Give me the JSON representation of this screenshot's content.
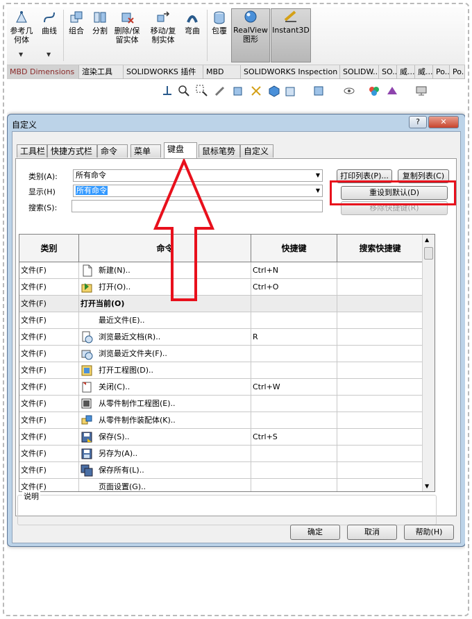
{
  "ribbon": {
    "buttons": [
      {
        "label": "参考几\n何体",
        "icon": "reference-geometry-icon"
      },
      {
        "label": "曲线",
        "icon": "curves-icon"
      },
      {
        "label": "组合",
        "icon": "combine-icon"
      },
      {
        "label": "分割",
        "icon": "split-icon"
      },
      {
        "label": "删除/保\n留实体",
        "icon": "delete-keep-body-icon"
      },
      {
        "label": "移动/复\n制实体",
        "icon": "move-copy-body-icon"
      },
      {
        "label": "弯曲",
        "icon": "flex-icon"
      },
      {
        "label": "包覆",
        "icon": "wrap-icon"
      },
      {
        "label": "RealView\n图形",
        "icon": "realview-icon"
      },
      {
        "label": "Instant3D",
        "icon": "instant3d-icon"
      }
    ]
  },
  "command_tabs": [
    "MBD Dimensions",
    "渲染工具",
    "SOLIDWORKS 插件",
    "MBD",
    "SOLIDWORKS Inspection",
    "SOLIDW...",
    "SO...",
    "威...",
    "威...",
    "Po...",
    "Po..."
  ],
  "dialog": {
    "title": "自定义",
    "help_label": "?",
    "close_label": "✕",
    "tabs": [
      "工具栏",
      "快捷方式栏",
      "命令",
      "菜单",
      "键盘",
      "鼠标笔势",
      "自定义"
    ],
    "category_label": "类别(A):",
    "category_value": "所有命令",
    "show_label": "显示(H)",
    "show_value": "所有命令",
    "search_label": "搜索(S):",
    "search_value": "",
    "print_button": "打印列表(P)...",
    "copy_button": "复制列表(C)",
    "reset_button": "重设到默认(D)",
    "remove_button": "移除快捷键(R)",
    "columns": [
      "类别",
      "命令",
      "快捷键",
      "搜索快捷键"
    ],
    "rows": [
      {
        "cat": "文件(F)",
        "cmd": "新建(N)..",
        "key": "Ctrl+N",
        "search": "",
        "icon": "new-document-icon"
      },
      {
        "cat": "文件(F)",
        "cmd": "打开(O)..",
        "key": "Ctrl+O",
        "search": "",
        "icon": "open-folder-icon"
      },
      {
        "cat": "文件(F)",
        "cmd": "打开当前(O)",
        "key": "",
        "search": "",
        "icon": "",
        "header": true
      },
      {
        "cat": "文件(F)",
        "cmd": "最近文件(E)..",
        "key": "",
        "search": "",
        "icon": ""
      },
      {
        "cat": "文件(F)",
        "cmd": "浏览最近文档(R)..",
        "key": "R",
        "search": "",
        "icon": "browse-recent-docs-icon"
      },
      {
        "cat": "文件(F)",
        "cmd": "浏览最近文件夹(F)..",
        "key": "",
        "search": "",
        "icon": "browse-recent-folders-icon"
      },
      {
        "cat": "文件(F)",
        "cmd": "打开工程图(D)..",
        "key": "",
        "search": "",
        "icon": "open-drawing-icon"
      },
      {
        "cat": "文件(F)",
        "cmd": "关闭(C)..",
        "key": "Ctrl+W",
        "search": "",
        "icon": "close-document-icon"
      },
      {
        "cat": "文件(F)",
        "cmd": "从零件制作工程图(E)..",
        "key": "",
        "search": "",
        "icon": "make-drawing-icon"
      },
      {
        "cat": "文件(F)",
        "cmd": "从零件制作装配体(K)..",
        "key": "",
        "search": "",
        "icon": "make-assembly-icon"
      },
      {
        "cat": "文件(F)",
        "cmd": "保存(S)..",
        "key": "Ctrl+S",
        "search": "",
        "icon": "save-icon"
      },
      {
        "cat": "文件(F)",
        "cmd": "另存为(A)..",
        "key": "",
        "search": "",
        "icon": "save-as-icon"
      },
      {
        "cat": "文件(F)",
        "cmd": "保存所有(L)..",
        "key": "",
        "search": "",
        "icon": "save-all-icon"
      },
      {
        "cat": "文件(F)",
        "cmd": "页面设置(G)..",
        "key": "",
        "search": "",
        "icon": ""
      }
    ],
    "description_label": "说明",
    "ok_button": "确定",
    "cancel_button": "取消",
    "helpbtn_label": "帮助(H)"
  },
  "colors": {
    "highlight": "#e8101c",
    "title_bar": "#bcd3e8",
    "selection": "#3399ff"
  }
}
